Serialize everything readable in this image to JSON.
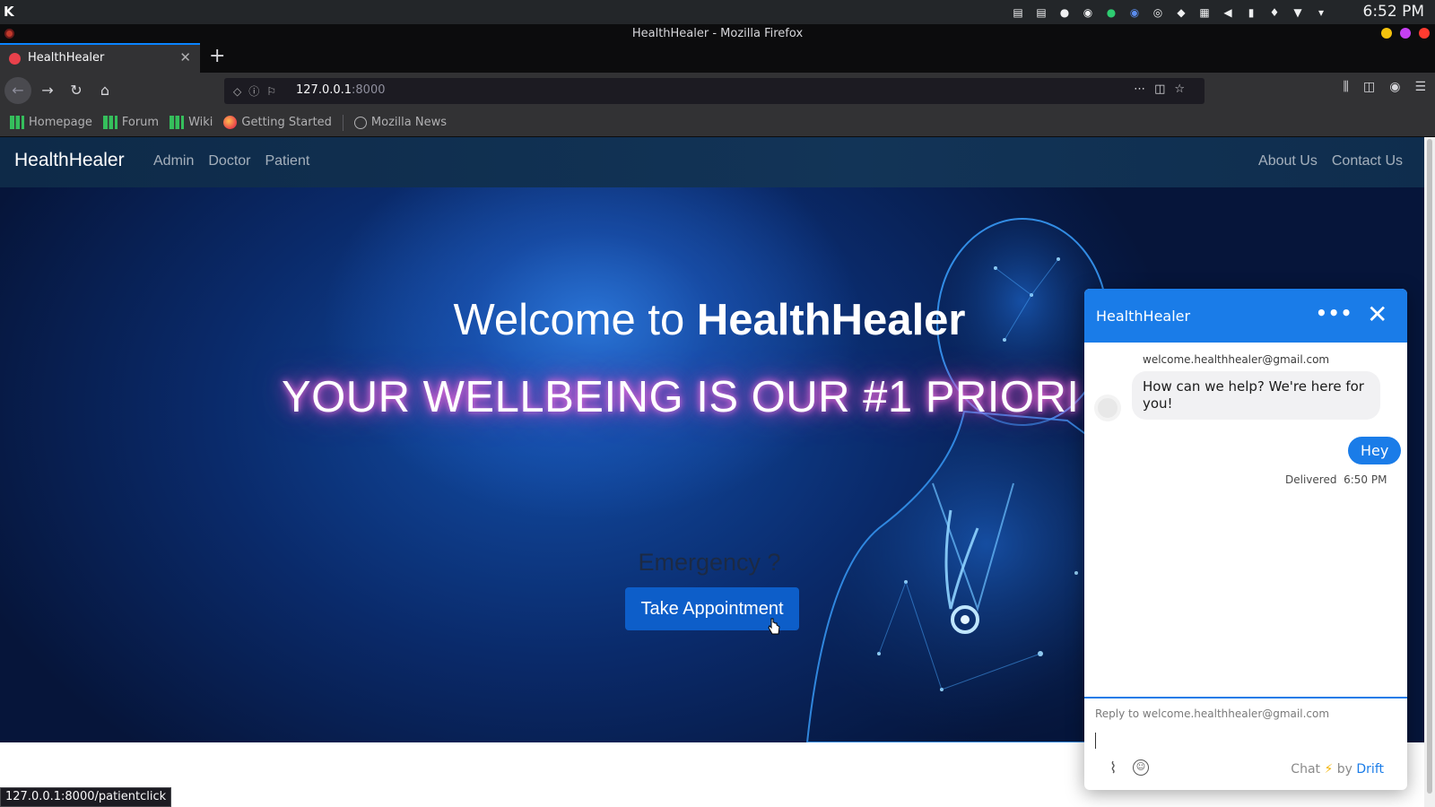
{
  "os": {
    "clock": "6:52 PM"
  },
  "window": {
    "title": "HealthHealer - Mozilla Firefox"
  },
  "tabs": [
    {
      "label": "HealthHealer"
    }
  ],
  "urlbar": {
    "host": "127.0.0.1",
    "port": ":8000"
  },
  "bookmarks": [
    {
      "label": "Homepage",
      "icon": "manjaro-icon"
    },
    {
      "label": "Forum",
      "icon": "manjaro-icon"
    },
    {
      "label": "Wiki",
      "icon": "manjaro-icon"
    },
    {
      "label": "Getting Started",
      "icon": "firefox-icon"
    },
    {
      "label": "Mozilla News",
      "icon": "globe-icon"
    }
  ],
  "site": {
    "brand": "HealthHealer",
    "nav_left": [
      "Admin",
      "Doctor",
      "Patient"
    ],
    "nav_right": [
      "About Us",
      "Contact Us"
    ],
    "hero": {
      "welcome_prefix": "Welcome to",
      "welcome_brand": "HealthHealer",
      "tagline": "YOUR WELLBEING IS OUR #1 PRIORI",
      "emergency": "Emergency ?",
      "cta": "Take Appointment"
    }
  },
  "chat": {
    "title": "HealthHealer",
    "sender": "welcome.healthhealer@gmail.com",
    "incoming": "How can we help? We're here for you!",
    "outgoing": "Hey",
    "delivered_label": "Delivered",
    "delivered_time": "6:50 PM",
    "reply_placeholder": "Reply to welcome.healthhealer@gmail.com",
    "powered_chat": "Chat",
    "powered_by": "by",
    "powered_brand": "Drift"
  },
  "status_link": "127.0.0.1:8000/patientclick",
  "colors": {
    "accent": "#1a7ce8",
    "button": "#0d5ec9",
    "navbar": "#123457"
  }
}
